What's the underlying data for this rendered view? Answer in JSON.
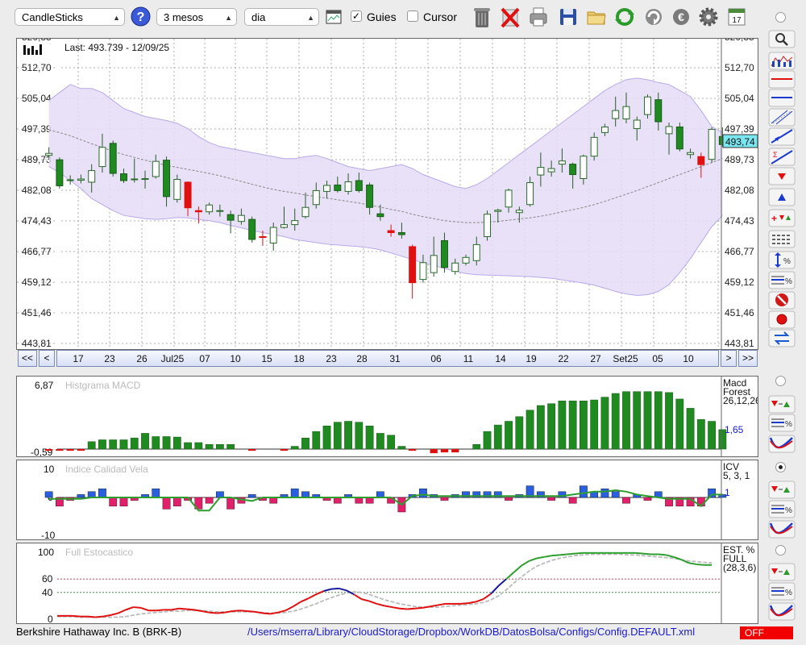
{
  "toolbar": {
    "chart_type": "CandleSticks",
    "period": "3 mesos",
    "interval": "dia",
    "guides_label": "Guies",
    "guides_checked": true,
    "cursor_label": "Cursor",
    "cursor_checked": false,
    "icons": [
      "help-icon",
      "chart-settings-icon",
      "trash-icon",
      "delete-icon",
      "printer-icon",
      "save-icon",
      "folder-icon",
      "refresh-icon",
      "update-icon",
      "currency-icon",
      "gear-icon",
      "calendar-icon"
    ]
  },
  "side_tools": [
    "zoom-icon",
    "bollinger-icon",
    "horizontal-line-icon",
    "horizontal-line-blue-icon",
    "channel-icon",
    "trendline-icon",
    "fibonacci-icon",
    "arrow-down-icon",
    "arrow-up-icon",
    "add-signals-icon",
    "levels-icon",
    "percent-range-icon",
    "percent-lines-icon",
    "stop-icon",
    "record-icon",
    "swap-icon"
  ],
  "chart_data": [
    {
      "type": "candlestick",
      "title": "",
      "last_label": "Last: 493.739 - 12/09/25",
      "current_value_label": "493,74",
      "y_ticks": [
        "520,35",
        "512,70",
        "505,04",
        "497,39",
        "489,73",
        "482,08",
        "474,43",
        "466,77",
        "459,12",
        "451,46",
        "443,81"
      ],
      "ylim": [
        443.81,
        520.35
      ],
      "x_labels": [
        "17",
        "23",
        "26",
        "Jul25",
        "07",
        "10",
        "15",
        "18",
        "23",
        "28",
        "31",
        "06",
        "11",
        "14",
        "19",
        "22",
        "27",
        "Set25",
        "05",
        "10"
      ],
      "candles": [
        {
          "o": 490.8,
          "c": 491.3,
          "h": 492.8,
          "l": 490.0
        },
        {
          "o": 489.7,
          "c": 483.2,
          "h": 490.3,
          "l": 482.5
        },
        {
          "o": 484.5,
          "c": 484.7,
          "h": 485.8,
          "l": 483.5
        },
        {
          "o": 484.6,
          "c": 484.9,
          "h": 486.0,
          "l": 483.8
        },
        {
          "o": 484.1,
          "c": 487.0,
          "h": 488.6,
          "l": 481.5
        },
        {
          "o": 488.0,
          "c": 492.8,
          "h": 496.2,
          "l": 486.5
        },
        {
          "o": 493.8,
          "c": 486.3,
          "h": 494.5,
          "l": 485.5
        },
        {
          "o": 486.2,
          "c": 484.5,
          "h": 487.5,
          "l": 483.9
        },
        {
          "o": 484.9,
          "c": 484.9,
          "h": 490.0,
          "l": 484.0
        },
        {
          "o": 485.0,
          "c": 485.0,
          "h": 487.0,
          "l": 482.5
        },
        {
          "o": 485.5,
          "c": 489.3,
          "h": 491.0,
          "l": 485.0
        },
        {
          "o": 489.6,
          "c": 480.5,
          "h": 490.5,
          "l": 478.0
        },
        {
          "o": 479.8,
          "c": 484.8,
          "h": 486.0,
          "l": 479.0
        },
        {
          "o": 484.1,
          "c": 477.7,
          "h": 484.3,
          "l": 475.6
        },
        {
          "o": 477.0,
          "c": 476.7,
          "h": 478.0,
          "l": 473.8
        },
        {
          "o": 476.7,
          "c": 478.4,
          "h": 479.0,
          "l": 476.0
        },
        {
          "o": 477.0,
          "c": 477.0,
          "h": 478.5,
          "l": 475.5
        },
        {
          "o": 476.0,
          "c": 474.6,
          "h": 477.0,
          "l": 471.3
        },
        {
          "o": 474.3,
          "c": 475.8,
          "h": 477.5,
          "l": 473.5
        },
        {
          "o": 474.8,
          "c": 469.8,
          "h": 475.5,
          "l": 469.0
        },
        {
          "o": 470.5,
          "c": 470.3,
          "h": 472.0,
          "l": 468.2
        },
        {
          "o": 468.9,
          "c": 472.8,
          "h": 474.0,
          "l": 467.0
        },
        {
          "o": 472.8,
          "c": 473.5,
          "h": 478.0,
          "l": 472.5
        },
        {
          "o": 473.5,
          "c": 474.5,
          "h": 477.5,
          "l": 472.0
        },
        {
          "o": 475.5,
          "c": 477.8,
          "h": 481.5,
          "l": 475.0
        },
        {
          "o": 478.5,
          "c": 482.0,
          "h": 484.0,
          "l": 477.5
        },
        {
          "o": 481.8,
          "c": 483.3,
          "h": 484.5,
          "l": 480.0
        },
        {
          "o": 483.4,
          "c": 482.0,
          "h": 485.5,
          "l": 481.5
        },
        {
          "o": 481.8,
          "c": 484.2,
          "h": 486.3,
          "l": 481.0
        },
        {
          "o": 484.5,
          "c": 482.0,
          "h": 486.5,
          "l": 481.5
        },
        {
          "o": 483.4,
          "c": 477.8,
          "h": 484.0,
          "l": 476.0
        },
        {
          "o": 476.2,
          "c": 475.5,
          "h": 478.5,
          "l": 474.5
        },
        {
          "o": 472.0,
          "c": 471.5,
          "h": 473.5,
          "l": 470.5
        },
        {
          "o": 471.5,
          "c": 471.0,
          "h": 474.0,
          "l": 470.0
        },
        {
          "o": 468.0,
          "c": 459.0,
          "h": 468.5,
          "l": 455.0
        },
        {
          "o": 459.8,
          "c": 464.0,
          "h": 466.0,
          "l": 459.0
        },
        {
          "o": 461.5,
          "c": 465.8,
          "h": 470.5,
          "l": 460.5
        },
        {
          "o": 469.5,
          "c": 462.8,
          "h": 471.5,
          "l": 461.5
        },
        {
          "o": 461.8,
          "c": 463.9,
          "h": 465.0,
          "l": 461.0
        },
        {
          "o": 463.9,
          "c": 465.3,
          "h": 466.0,
          "l": 463.3
        },
        {
          "o": 464.5,
          "c": 468.5,
          "h": 470.5,
          "l": 463.3
        },
        {
          "o": 470.5,
          "c": 476.1,
          "h": 477.0,
          "l": 469.5
        },
        {
          "o": 476.8,
          "c": 477.1,
          "h": 477.5,
          "l": 474.0
        },
        {
          "o": 477.9,
          "c": 482.1,
          "h": 482.5,
          "l": 476.5
        },
        {
          "o": 476.5,
          "c": 477.1,
          "h": 478.0,
          "l": 474.0
        },
        {
          "o": 478.5,
          "c": 484.0,
          "h": 485.5,
          "l": 478.0
        },
        {
          "o": 485.9,
          "c": 487.8,
          "h": 491.5,
          "l": 483.0
        },
        {
          "o": 486.7,
          "c": 487.5,
          "h": 489.5,
          "l": 485.5
        },
        {
          "o": 488.6,
          "c": 489.4,
          "h": 492.5,
          "l": 486.5
        },
        {
          "o": 488.6,
          "c": 486.0,
          "h": 489.0,
          "l": 482.5
        },
        {
          "o": 485.0,
          "c": 490.6,
          "h": 491.0,
          "l": 483.5
        },
        {
          "o": 490.6,
          "c": 495.3,
          "h": 496.5,
          "l": 489.5
        },
        {
          "o": 496.5,
          "c": 497.9,
          "h": 498.7,
          "l": 495.6
        },
        {
          "o": 500.0,
          "c": 502.0,
          "h": 505.5,
          "l": 498.0
        },
        {
          "o": 499.9,
          "c": 503.0,
          "h": 506.5,
          "l": 498.8
        },
        {
          "o": 497.5,
          "c": 499.6,
          "h": 500.5,
          "l": 494.5
        },
        {
          "o": 501.0,
          "c": 505.4,
          "h": 506.0,
          "l": 500.0
        },
        {
          "o": 504.7,
          "c": 499.2,
          "h": 506.5,
          "l": 497.0
        },
        {
          "o": 496.2,
          "c": 498.0,
          "h": 499.0,
          "l": 491.0
        },
        {
          "o": 497.9,
          "c": 492.4,
          "h": 499.0,
          "l": 491.8
        },
        {
          "o": 491.0,
          "c": 491.5,
          "h": 492.5,
          "l": 490.0
        },
        {
          "o": 490.5,
          "c": 488.5,
          "h": 491.5,
          "l": 485.2
        },
        {
          "o": 489.8,
          "c": 497.3,
          "h": 497.8,
          "l": 489.0
        },
        {
          "o": 495.5,
          "c": 493.5,
          "h": 497.8,
          "l": 493.0
        }
      ],
      "bollinger": {
        "upper": [
          504.5,
          506.5,
          508.5,
          507.5,
          507.5,
          506.5,
          504.5,
          502.5,
          501.5,
          500.5,
          500.0,
          499.5,
          498.8,
          497.5,
          495.5,
          494.0,
          493.0,
          492.5,
          492.0,
          491.5,
          491.0,
          490.5,
          490.0,
          490.0,
          490.5,
          490.8,
          490.0,
          489.0,
          488.0,
          487.5,
          487.0,
          487.5,
          488.0,
          488.5,
          487.5,
          486.0,
          485.0,
          484.0,
          483.0,
          482.5,
          483.5,
          485.0,
          487.0,
          489.0,
          491.0,
          493.0,
          495.0,
          497.0,
          499.0,
          501.0,
          503.0,
          505.0,
          507.0,
          508.5,
          509.7,
          510.1,
          509.7,
          509.0,
          508.5,
          507.0,
          505.5,
          502.0,
          498.0,
          496.5
        ],
        "middle": [
          497.1,
          496.5,
          495.7,
          494.7,
          493.7,
          492.8,
          491.8,
          491.0,
          490.3,
          489.6,
          488.9,
          488.3,
          487.8,
          487.3,
          486.8,
          486.3,
          485.7,
          485.0,
          484.3,
          483.6,
          482.9,
          482.3,
          481.8,
          481.4,
          480.9,
          480.5,
          480.1,
          479.7,
          479.3,
          478.9,
          478.4,
          477.9,
          477.3,
          476.8,
          476.1,
          475.5,
          475.0,
          474.5,
          474.2,
          474.0,
          474.0,
          474.1,
          474.3,
          474.6,
          474.9,
          475.2,
          475.6,
          476.1,
          476.7,
          477.2,
          477.8,
          478.5,
          479.3,
          480.2,
          481.1,
          482.0,
          483.0,
          484.0,
          485.0,
          486.0,
          487.0,
          488.0,
          489.0,
          490.0
        ],
        "lower": [
          488.0,
          486.5,
          484.5,
          482.5,
          480.0,
          478.5,
          477.0,
          475.8,
          475.4,
          475.0,
          474.8,
          475.0,
          475.3,
          475.2,
          474.8,
          474.5,
          474.0,
          473.3,
          472.7,
          472.0,
          471.5,
          471.0,
          470.5,
          469.8,
          469.4,
          469.0,
          468.6,
          468.4,
          468.2,
          468.0,
          467.7,
          467.2,
          466.4,
          465.6,
          464.8,
          464.0,
          463.3,
          462.5,
          461.9,
          461.3,
          461.0,
          460.9,
          460.8,
          460.7,
          460.6,
          460.5,
          460.3,
          460.1,
          459.7,
          459.3,
          458.9,
          458.4,
          457.6,
          456.8,
          456.2,
          455.8,
          456.0,
          456.8,
          458.5,
          461.5,
          465.0,
          469.0,
          473.0,
          475.8
        ]
      }
    },
    {
      "type": "bar",
      "title": "Histgrama MACD",
      "legend": [
        "Macd",
        "Forest",
        "26,12,26"
      ],
      "value_label": "1,65",
      "y_ticks": [
        "6,87",
        "-0,59"
      ],
      "ylim": [
        -0.59,
        6.87
      ],
      "values": [
        -0.2,
        -0.2,
        -0.15,
        -0.1,
        0.8,
        1.0,
        1.0,
        1.0,
        1.2,
        1.7,
        1.35,
        1.35,
        1.3,
        0.7,
        0.7,
        0.5,
        0.5,
        0.5,
        0,
        -0.1,
        0,
        0,
        -0.1,
        0.3,
        1.2,
        1.9,
        2.5,
        2.9,
        3.0,
        2.9,
        2.5,
        1.7,
        1.5,
        0.3,
        -0.1,
        0,
        -0.5,
        -0.4,
        -0.4,
        0,
        0.5,
        1.9,
        2.6,
        3.0,
        3.5,
        4.2,
        4.7,
        4.9,
        5.2,
        5.2,
        5.2,
        5.3,
        5.6,
        6.0,
        6.2,
        6.2,
        6.2,
        6.2,
        6.1,
        5.4,
        4.4,
        3.2,
        3.0,
        2.1
      ]
    },
    {
      "type": "bar",
      "title": "Indice Calidad Vela",
      "legend": [
        "ICV",
        "5, 3, 1"
      ],
      "value_label": "1",
      "y_ticks": [
        "10",
        "0",
        "-10"
      ],
      "ylim": [
        -10,
        10
      ],
      "values": [
        2,
        -3,
        -1,
        1,
        2,
        3,
        -3,
        -3,
        -1,
        1,
        3,
        -4,
        -3,
        -1,
        -4,
        -2,
        2,
        -4,
        -2,
        1,
        -1,
        -2,
        1,
        3,
        2,
        1,
        -1,
        -2,
        1,
        -2,
        -2,
        2,
        -2,
        -5,
        1,
        3,
        1,
        -1,
        1,
        2,
        2,
        2,
        2,
        -1,
        1,
        4,
        2,
        -1,
        2,
        -2,
        4,
        2,
        3,
        2,
        -2,
        1,
        -1,
        2,
        -3,
        -3,
        -3,
        -3,
        3,
        1
      ],
      "line": [
        -0.5,
        -0.5,
        -0.5,
        -0.5,
        0,
        0,
        0,
        0,
        0,
        0,
        0,
        0,
        0,
        0,
        -4.5,
        -4.5,
        0,
        0,
        -0.7,
        -1.2,
        0,
        0,
        0,
        0,
        0,
        0,
        0,
        0,
        0,
        0,
        0,
        0,
        0,
        -2.5,
        0.5,
        1,
        0.5,
        0.5,
        0.5,
        0.5,
        0.5,
        0.5,
        0.5,
        0.5,
        0.5,
        0.5,
        0.5,
        0.5,
        0.5,
        1,
        1.5,
        2,
        2,
        2.5,
        2,
        1,
        0.5,
        0,
        -0.5,
        -0.5,
        -0.5,
        -3,
        1,
        1
      ]
    },
    {
      "type": "line",
      "title": "Full Estocastico",
      "legend": [
        "EST. %",
        "FULL",
        "(28,3,6)"
      ],
      "y_ticks": [
        "100",
        "60",
        "40",
        "0"
      ],
      "ylim": [
        0,
        100
      ],
      "k_line": [
        5,
        5,
        5,
        4,
        4,
        3,
        4,
        6,
        9,
        14,
        18,
        17,
        13,
        13,
        14,
        14,
        16,
        15,
        14,
        12,
        10,
        9,
        10,
        12,
        13,
        12,
        11,
        9,
        8,
        10,
        13,
        19,
        26,
        31,
        37,
        42,
        45,
        46,
        43,
        37,
        30,
        27,
        23,
        20,
        18,
        16,
        15,
        16,
        17,
        19,
        21,
        23,
        23,
        23,
        24,
        26,
        30,
        38,
        50,
        60,
        70,
        80,
        87,
        91,
        93,
        95,
        96,
        97,
        98,
        99,
        99,
        99,
        99,
        99,
        99,
        99,
        99,
        98,
        97,
        97,
        96,
        93,
        89,
        84,
        82,
        81,
        81
      ],
      "d_line": [
        4,
        4,
        4,
        3,
        3,
        3,
        3,
        3,
        3,
        4,
        6,
        8,
        9,
        10,
        11,
        12,
        12,
        13,
        13,
        13,
        12,
        11,
        11,
        11,
        11,
        11,
        11,
        10,
        9,
        9,
        10,
        12,
        15,
        19,
        23,
        28,
        32,
        36,
        39,
        41,
        40,
        37,
        33,
        29,
        26,
        23,
        21,
        19,
        18,
        18,
        18,
        19,
        20,
        21,
        22,
        23,
        25,
        29,
        35,
        44,
        54,
        63,
        72,
        79,
        84,
        88,
        91,
        93,
        95,
        96,
        97,
        97,
        97,
        97,
        97,
        96,
        96,
        95,
        94,
        93,
        92,
        91,
        89,
        87,
        86,
        85,
        84
      ]
    }
  ],
  "navigator": {
    "first_button": "<<",
    "prev_button": "<",
    "next_button": ">",
    "last_button": ">>"
  },
  "status": {
    "company": "Berkshire Hathaway Inc. B (BRK-B)",
    "path": "/Users/mserra/Library/CloudStorage/Dropbox/WorkDB/DatosBolsa/Configs/Config.DEFAULT.xml",
    "mode": "OFF"
  },
  "colors": {
    "up": "#1f8a1f",
    "down": "#e01010",
    "band_fill": "#e5dcf7",
    "band_line": "#b9a9e8",
    "icv_pos": "#2a5fe0",
    "icv_neg": "#e0206a",
    "icv_line": "#2e9e2e",
    "stoch_k": "#2e9e2e",
    "stoch_k_low": "#e01010",
    "stoch_k_mid": "#1a1a9a",
    "stoch_d": "#bbbbbb",
    "current_box": "#7ae6f0",
    "path": "#1a1ad0"
  }
}
